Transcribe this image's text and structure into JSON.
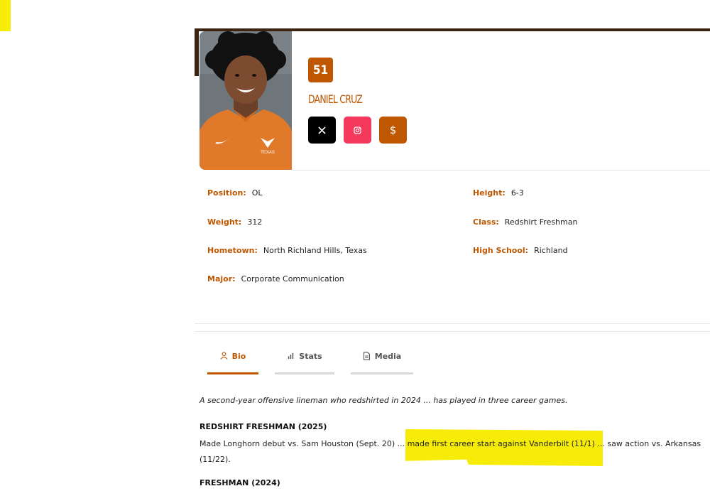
{
  "player": {
    "number": "51",
    "name": "DANIEL CRUZ",
    "jersey_logo": "TEXAS"
  },
  "social": {
    "x_icon": "x-logo-icon",
    "instagram_icon": "instagram-icon",
    "nil_icon": "$"
  },
  "details": {
    "position_label": "Position:",
    "position": "OL",
    "height_label": "Height:",
    "height": "6-3",
    "weight_label": "Weight:",
    "weight": "312",
    "class_label": "Class:",
    "class": "Redshirt Freshman",
    "hometown_label": "Hometown:",
    "hometown": "North Richland Hills, Texas",
    "high_school_label": "High School:",
    "high_school": "Richland",
    "major_label": "Major:",
    "major": "Corporate Communication"
  },
  "tabs": [
    {
      "label": "Bio",
      "icon": "person-icon",
      "active": true
    },
    {
      "label": "Stats",
      "icon": "bar-chart-icon",
      "active": false
    },
    {
      "label": "Media",
      "icon": "document-icon",
      "active": false
    }
  ],
  "bio": {
    "intro": "A second-year offensive lineman who redshirted in 2024 ... has played in three career games.",
    "sections": [
      {
        "heading": "REDSHIRT FRESHMAN (2025)",
        "text": "Made Longhorn debut vs. Sam Houston (Sept. 20) ... made first career start against Vanderbilt (11/1) ... saw action vs. Arkansas (11/22)."
      },
      {
        "heading": "FRESHMAN (2024)",
        "text": ""
      }
    ]
  },
  "colors": {
    "accent": "#bf5700",
    "dark": "#3b2512",
    "highlight": "#f7ec07",
    "instagram": "#f5395c"
  }
}
